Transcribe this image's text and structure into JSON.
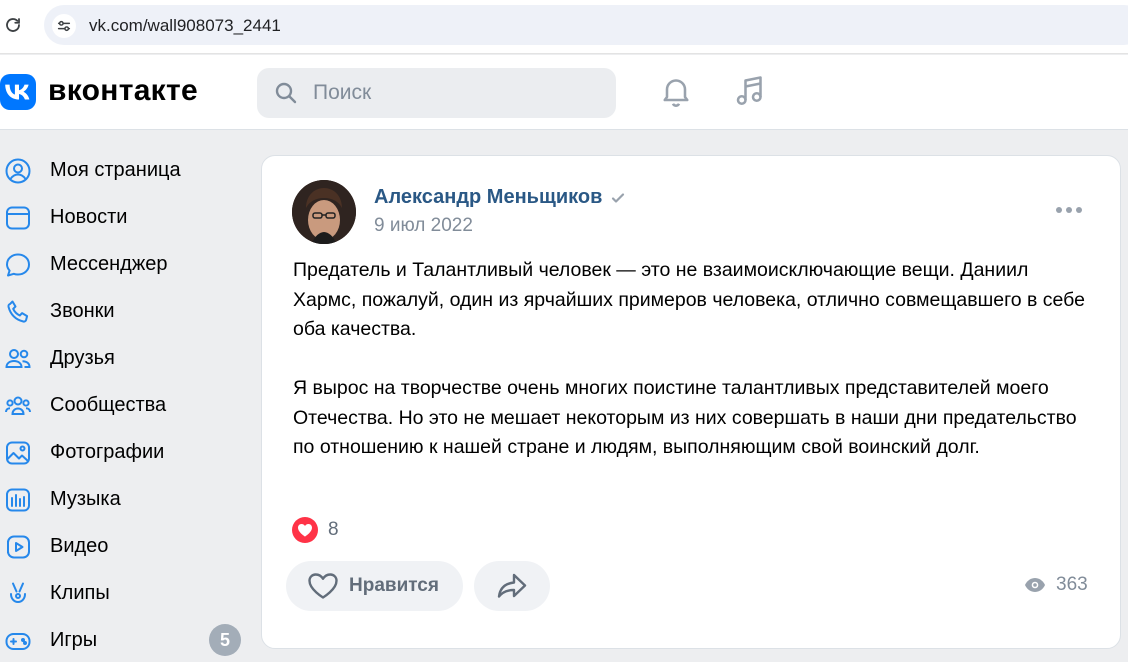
{
  "browser": {
    "url": "vk.com/wall908073_2441"
  },
  "header": {
    "logo_text": "вконтакте",
    "search_placeholder": "Поиск"
  },
  "sidebar": {
    "items": [
      {
        "label": "Моя страница",
        "icon": "profile-icon"
      },
      {
        "label": "Новости",
        "icon": "news-icon"
      },
      {
        "label": "Мессенджер",
        "icon": "messenger-icon"
      },
      {
        "label": "Звонки",
        "icon": "phone-icon"
      },
      {
        "label": "Друзья",
        "icon": "friends-icon"
      },
      {
        "label": "Сообщества",
        "icon": "communities-icon"
      },
      {
        "label": "Фотографии",
        "icon": "photos-icon"
      },
      {
        "label": "Музыка",
        "icon": "music-icon"
      },
      {
        "label": "Видео",
        "icon": "video-icon"
      },
      {
        "label": "Клипы",
        "icon": "clips-icon"
      },
      {
        "label": "Игры",
        "icon": "games-icon",
        "badge": "5"
      }
    ]
  },
  "post": {
    "author": "Александр Меньщиков",
    "date": "9 июл 2022",
    "paragraphs": [
      "Предатель и Талантливый человек — это не взаимоисключающие вещи. Даниил Хармс, пожалуй, один из ярчайших примеров человека, отлично совмещавшего в себе оба качества.",
      "Я вырос на творчестве очень многих поистине талантливых представителей моего Отечества. Но это не мешает некоторым из них совершать в наши дни предательство по отношению к нашей стране и людям, выполняющим свой воинский долг."
    ],
    "reactions_count": "8",
    "like_label": "Нравится",
    "views": "363"
  },
  "colors": {
    "accent": "#0077ff",
    "author_link": "#2a5885",
    "reaction": "#ff3347",
    "background": "#edeef0"
  }
}
